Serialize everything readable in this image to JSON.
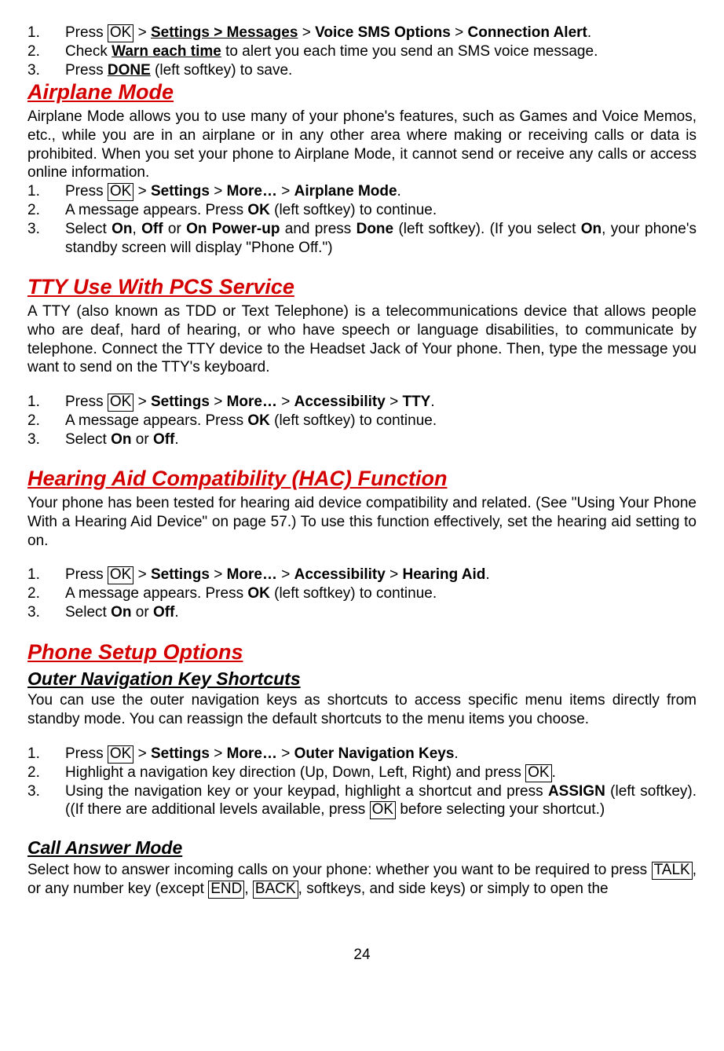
{
  "list1": {
    "i1": {
      "press": "Press ",
      "ok": "OK",
      "gt1": " > ",
      "settings": "Settings > Messages",
      "gt2": " > ",
      "vso": "Voice SMS Options",
      "gt3": " > ",
      "ca": "Connection Alert",
      "dot": "."
    },
    "i2": {
      "a": "Check ",
      "b": "Warn each time",
      "c": " to alert you each time you send an SMS voice message."
    },
    "i3": {
      "a": "Press ",
      "b": "DONE",
      "c": " (left softkey) to save."
    }
  },
  "airplane": {
    "title": "Airplane Mode",
    "para": "Airplane Mode allows you to use many of your phone's features, such as Games and Voice Memos, etc., while you are in an airplane or in any other area where making or receiving calls or data is prohibited. When you set your phone to Airplane Mode, it cannot send or receive any calls or access online information.",
    "i1": {
      "press": "Press ",
      "ok": "OK",
      "gt1": " > ",
      "settings": "Settings",
      "gt2": " > ",
      "more": "More…",
      "gt3": " > ",
      "am": "Airplane Mode",
      "dot": "."
    },
    "i2": {
      "a": "A message appears. Press ",
      "b": "OK",
      "c": " (left softkey) to continue."
    },
    "i3": {
      "a": "Select ",
      "on": "On",
      "comma": ", ",
      "off": "Off",
      "or": " or ",
      "opu": "On Power-up",
      "and": " and press ",
      "done": "Done",
      "c": " (left softkey). (If you select ",
      "on2": "On",
      "d": ", your phone's standby screen will display \"Phone Off.\")"
    }
  },
  "tty": {
    "title": "TTY Use With PCS Service",
    "para": "A TTY (also known as TDD or Text Telephone) is a telecommunications device that allows people who are deaf, hard of hearing, or who have speech or language disabilities, to communicate by telephone. Connect the TTY device to the Headset Jack of Your phone. Then, type the message you want to send on the TTY's keyboard.",
    "i1": {
      "press": "Press ",
      "ok": "OK",
      "gt1": " > ",
      "settings": "Settings",
      "gt2": " > ",
      "more": "More…",
      "gt3": " > ",
      "acc": "Accessibility",
      "gt4": " > ",
      "tty": "TTY",
      "dot": "."
    },
    "i2": {
      "a": "A message appears. Press ",
      "b": "OK",
      "c": " (left softkey) to continue."
    },
    "i3": {
      "a": "Select ",
      "on": "On",
      "or": " or ",
      "off": "Off",
      "dot": "."
    }
  },
  "hac": {
    "title": "Hearing Aid Compatibility (HAC) Function",
    "para": "Your phone has been tested for hearing aid device compatibility and related. (See \"Using Your Phone With a Hearing Aid Device\" on page 57.) To use this function effectively, set the hearing aid setting to on.",
    "i1": {
      "press": "Press ",
      "ok": "OK",
      "gt1": " > ",
      "settings": "Settings",
      "gt2": " > ",
      "more": "More…",
      "gt3": " > ",
      "acc": "Accessibility",
      "gt4": " > ",
      "ha": "Hearing Aid",
      "dot": "."
    },
    "i2": {
      "a": "A message appears. Press ",
      "b": "OK",
      "c": " (left softkey) to continue."
    },
    "i3": {
      "a": "Select ",
      "on": "On",
      "or": " or ",
      "off": "Off",
      "dot": "."
    }
  },
  "setup": {
    "title": "Phone Setup Options",
    "sub1": "Outer Navigation Key Shortcuts",
    "para1": "You can use the outer navigation keys as shortcuts to access specific menu items directly from standby mode. You can reassign the default shortcuts to the menu items you choose.",
    "i1": {
      "press": "Press ",
      "ok": "OK",
      "gt1": " > ",
      "settings": "Settings",
      "gt2": " > ",
      "more": "More…",
      "gt3": " > ",
      "onk": "Outer Navigation Keys",
      "dot": "."
    },
    "i2": {
      "a": "Highlight a navigation key direction (Up, Down, Left, Right) and press ",
      "ok": "OK",
      "dot": "."
    },
    "i3": {
      "a": "Using the navigation key or your keypad, highlight a shortcut and press ",
      "assign": "ASSIGN",
      "b": " (left softkey). ((If there are additional levels available, press ",
      "ok": "OK",
      "c": " before selecting your shortcut.)"
    },
    "sub2": "Call Answer Mode",
    "para2a": "Select how to answer incoming calls on your phone: whether you want to be required to press ",
    "talk": "TALK",
    "para2b": ", or any number key (except ",
    "end": "END",
    "para2c": ",  ",
    "back": "BACK",
    "para2d": ", softkeys, and side keys) or simply to open the"
  },
  "pagenum": "24"
}
